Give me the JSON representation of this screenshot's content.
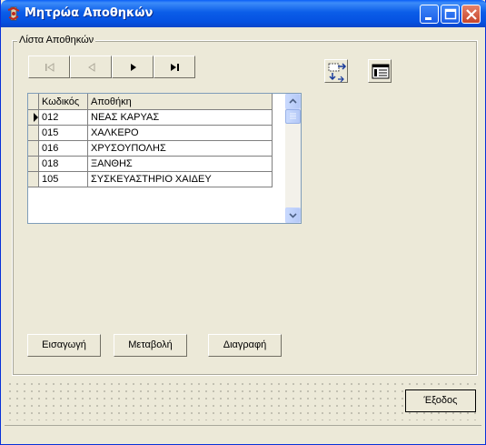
{
  "window": {
    "title": "Μητρώα Αποθηκών",
    "icon": "app-logo-icon"
  },
  "group": {
    "label": "Λίστα Αποθηκών"
  },
  "navigator": {
    "buttons": [
      "first-record-icon",
      "prior-record-icon",
      "next-record-icon",
      "last-record-icon"
    ]
  },
  "toolbar_icons": [
    "transfer-icon",
    "list-view-icon"
  ],
  "grid": {
    "columns": [
      "Κωδικός",
      "Αποθήκη"
    ],
    "rows": [
      {
        "code": "012",
        "name": "ΝΕΑΣ ΚΑΡΥΑΣ",
        "current": true
      },
      {
        "code": "015",
        "name": "ΧΑΛΚΕΡΟ",
        "current": false
      },
      {
        "code": "016",
        "name": "ΧΡΥΣΟΥΠΟΛΗΣ",
        "current": false
      },
      {
        "code": "018",
        "name": "ΞΑΝΘΗΣ",
        "current": false
      },
      {
        "code": "105",
        "name": "ΣΥΣΚΕΥΑΣΤΗΡΙΟ ΧΑΙΔΕΥ",
        "current": false
      }
    ]
  },
  "actions": {
    "insert": "Εισαγωγή",
    "modify": "Μεταβολή",
    "delete": "Διαγραφή"
  },
  "exit": "Έξοδος"
}
